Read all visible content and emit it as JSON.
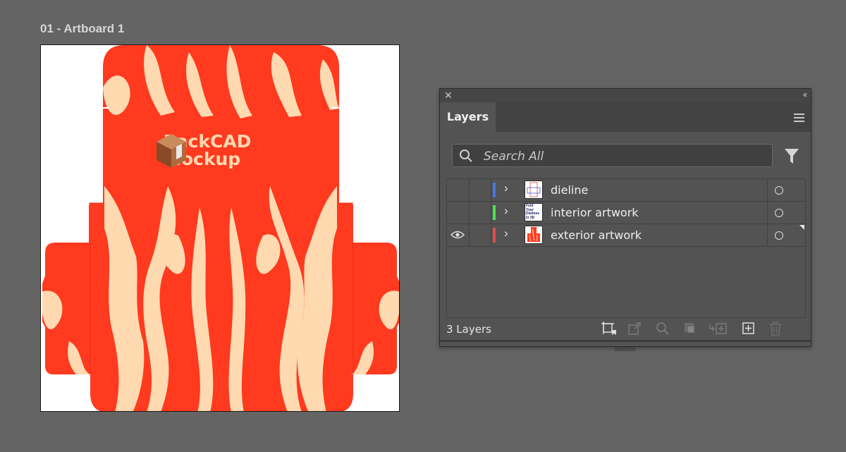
{
  "artboard": {
    "title": "01 - Artboard 1",
    "brand_line1": "PackCAD",
    "brand_line2": "Mockup",
    "colors": {
      "art_red": "#ff3a1f",
      "art_cream": "#ffd9b0"
    }
  },
  "layers_panel": {
    "close_icon": "close-icon",
    "collapse_icon": "double-chevron-left-icon",
    "tab_label": "Layers",
    "menu_icon": "hamburger-menu-icon",
    "search_placeholder": "Search All",
    "filter_icon": "filter-funnel-icon",
    "layers": [
      {
        "name": "dieline",
        "color": "#4a74e8",
        "visible": false,
        "thumbnail": "dieline-thumbnail",
        "thumb_text": ""
      },
      {
        "name": "interior artwork",
        "color": "#4fe04f",
        "visible": false,
        "thumbnail": "interior-thumbnail",
        "thumb_text": "Fold Your Dielines in 3D"
      },
      {
        "name": "exterior artwork",
        "color": "#e84a4a",
        "visible": true,
        "thumbnail": "exterior-thumbnail",
        "thumb_text": ""
      }
    ],
    "footer_count": "3 Layers",
    "footer_icons": [
      "collect-for-export-icon",
      "export-icon",
      "locate-object-icon",
      "make-clipping-mask-icon",
      "create-sublayer-icon",
      "new-layer-icon",
      "delete-icon"
    ]
  }
}
